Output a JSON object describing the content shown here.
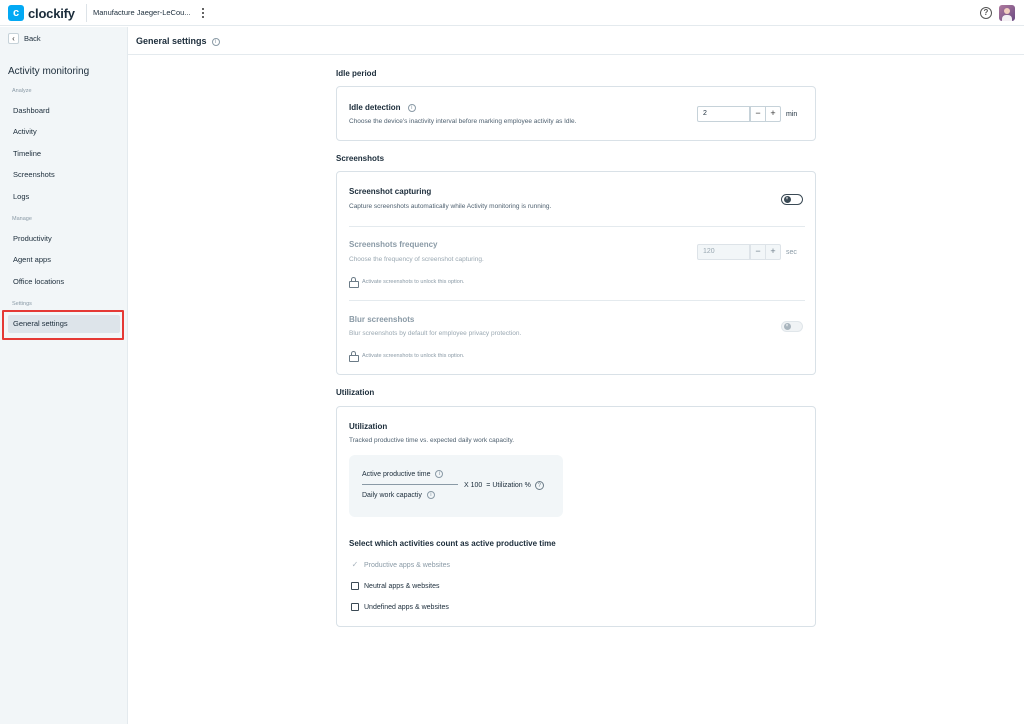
{
  "topbar": {
    "logo_letter": "c",
    "logo_text": "clockify",
    "workspace": "Manufacture Jaeger-LeCou...",
    "help_glyph": "?"
  },
  "sidebar": {
    "back_label": "Back",
    "title": "Activity monitoring",
    "sections": {
      "analyze": "Analyze",
      "manage": "Manage",
      "settings": "Settings"
    },
    "items": {
      "dashboard": "Dashboard",
      "activity": "Activity",
      "timeline": "Timeline",
      "screenshots": "Screenshots",
      "logs": "Logs",
      "productivity": "Productivity",
      "agent_apps": "Agent apps",
      "office_locations": "Office locations",
      "general_settings": "General settings"
    },
    "active_item": "General settings"
  },
  "header": {
    "title": "General settings"
  },
  "idle": {
    "heading": "Idle period",
    "title": "Idle detection",
    "description": "Choose the device's inactivity interval before marking employee activity as Idle.",
    "value": "2",
    "unit": "min"
  },
  "screenshots": {
    "heading": "Screenshots",
    "capturing": {
      "title": "Screenshot capturing",
      "description": "Capture screenshots automatically while Activity monitoring is running.",
      "enabled": false
    },
    "frequency": {
      "title": "Screenshots frequency",
      "description": "Choose the frequency of screenshot capturing.",
      "value": "120",
      "unit": "sec",
      "lock_note": "Activate screenshots to unlock this option."
    },
    "blur": {
      "title": "Blur screenshots",
      "description": "Blur screenshots by default for employee privacy protection.",
      "enabled": false,
      "lock_note": "Activate screenshots to unlock this option."
    }
  },
  "utilization": {
    "heading": "Utilization",
    "title": "Utilization",
    "description": "Tracked productive time vs. expected daily work capacity.",
    "formula": {
      "numerator": "Active productive time",
      "denominator": "Daily work capactiy",
      "multiplier": "X 100",
      "result": "= Utilization %"
    },
    "activities_title": "Select which activities count as active productive time",
    "options": {
      "productive": "Productive  apps & websites",
      "neutral": "Neutral apps & websites",
      "undefined": "Undefined apps & websites"
    }
  },
  "colors": {
    "brand": "#03a9f4",
    "highlight": "#e53935",
    "sidebar_bg": "#f2f6f8"
  }
}
